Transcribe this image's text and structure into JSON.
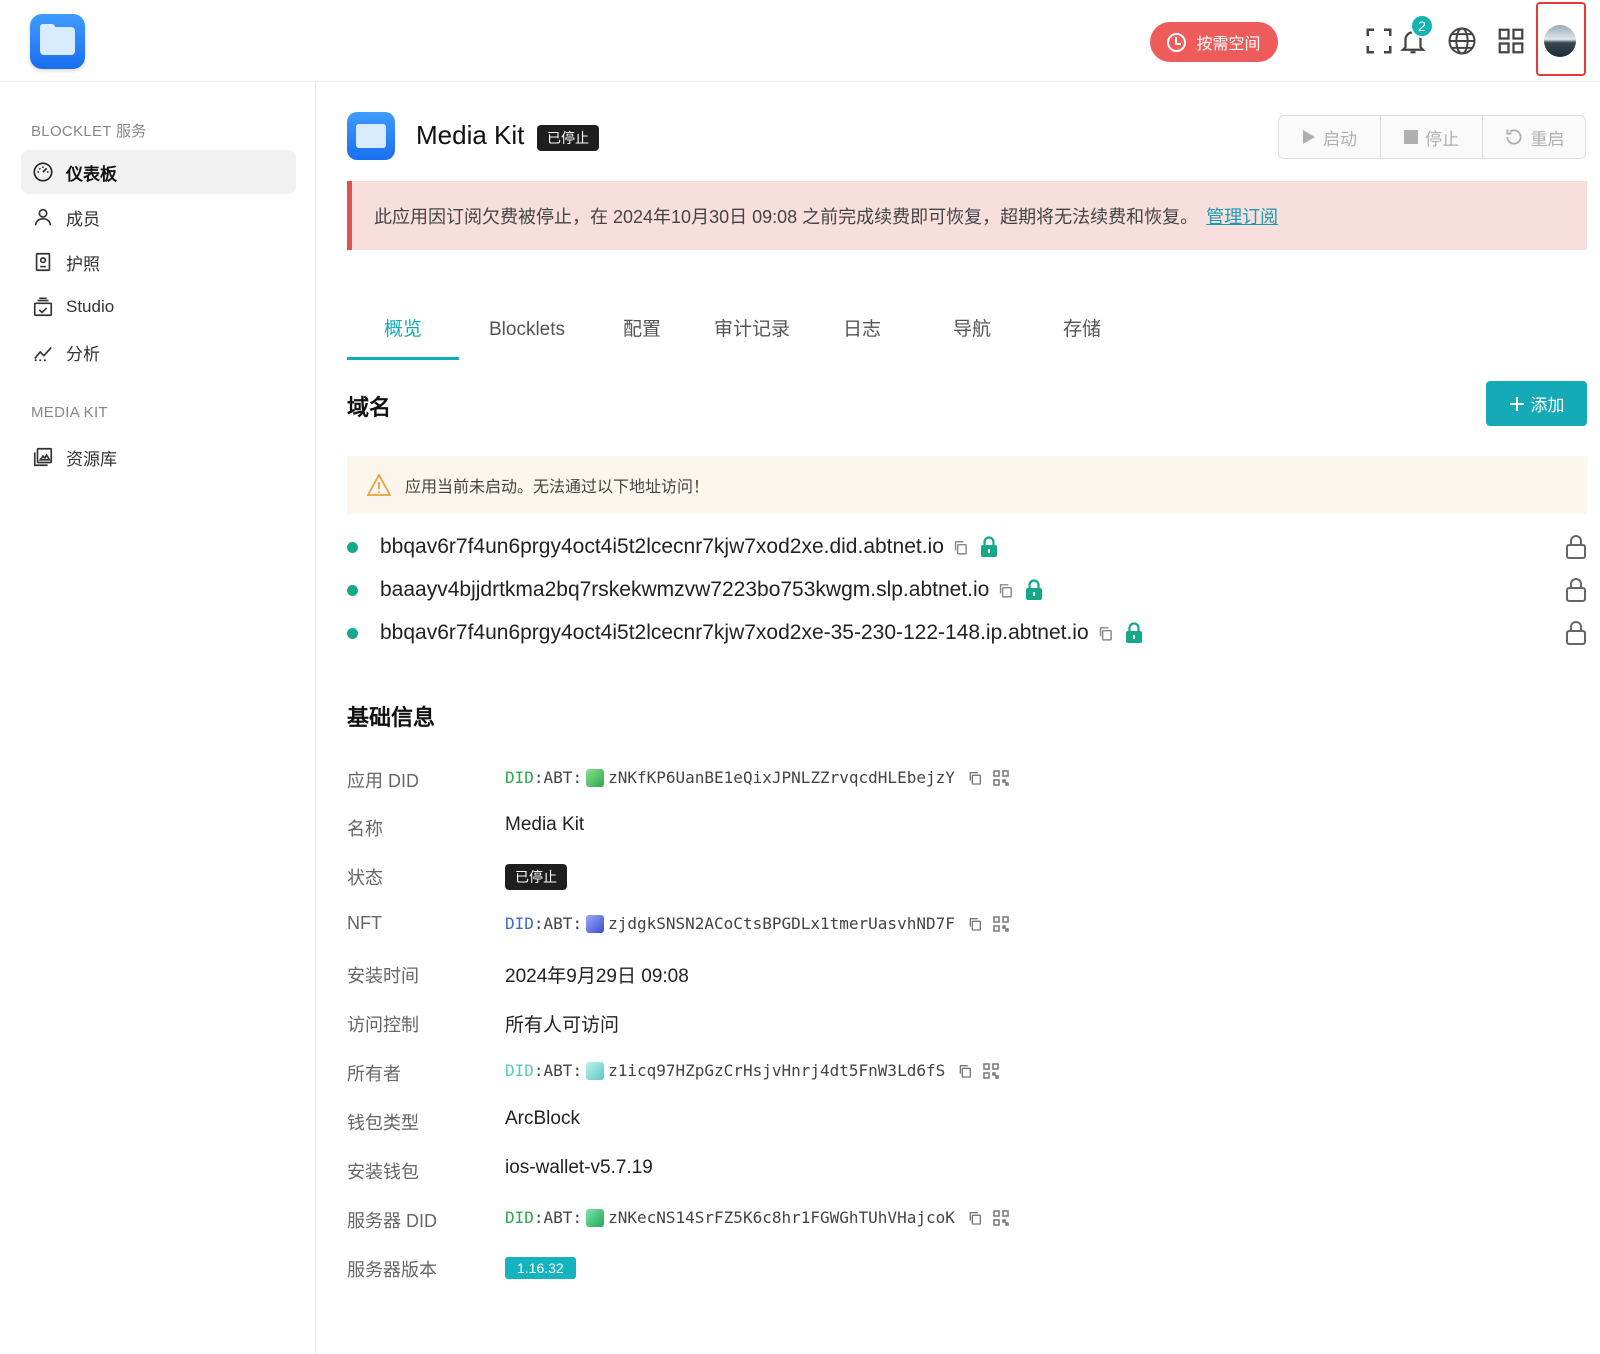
{
  "header": {
    "ondemand_label": "按需空间",
    "notification_count": "2"
  },
  "sidebar": {
    "section1": "BLOCKLET 服务",
    "items": [
      {
        "label": "仪表板",
        "icon": "dashboard-icon"
      },
      {
        "label": "成员",
        "icon": "user-icon"
      },
      {
        "label": "护照",
        "icon": "passport-icon"
      },
      {
        "label": "Studio",
        "icon": "studio-icon"
      },
      {
        "label": "分析",
        "icon": "analytics-icon"
      }
    ],
    "section2": "MEDIA KIT",
    "items2": [
      {
        "label": "资源库",
        "icon": "library-icon"
      }
    ]
  },
  "app": {
    "title": "Media Kit",
    "status": "已停止",
    "controls": {
      "start": "启动",
      "stop": "停止",
      "restart": "重启"
    }
  },
  "alert": {
    "text": "此应用因订阅欠费被停止，在 2024年10月30日 09:08 之前完成续费即可恢复，超期将无法续费和恢复。",
    "link": "管理订阅"
  },
  "tabs": [
    "概览",
    "Blocklets",
    "配置",
    "审计记录",
    "日志",
    "导航",
    "存储"
  ],
  "domains": {
    "title": "域名",
    "add_label": "添加",
    "warning": "应用当前未启动。无法通过以下地址访问！",
    "list": [
      "bbqav6r7f4un6prgy4oct4i5t2lcecnr7kjw7xod2xe.did.abtnet.io",
      "baaayv4bjjdrtkma2bq7rskekwmzvw7223bo753kwgm.slp.abtnet.io",
      "bbqav6r7f4un6prgy4oct4i5t2lcecnr7kjw7xod2xe-35-230-122-148.ip.abtnet.io"
    ]
  },
  "basic_info": {
    "title": "基础信息",
    "labels": {
      "app_did": "应用 DID",
      "name": "名称",
      "status": "状态",
      "nft": "NFT",
      "install_time": "安装时间",
      "access": "访问控制",
      "owner": "所有者",
      "wallet_type": "钱包类型",
      "install_wallet": "安装钱包",
      "server_did": "服务器 DID",
      "server_version": "服务器版本"
    },
    "values": {
      "did_prefix_did": "DID",
      "did_prefix_abt": ":ABT:",
      "app_did": "zNKfKP6UanBE1eQixJPNLZZrvqcdHLEbejzY",
      "name": "Media Kit",
      "status": "已停止",
      "nft": "zjdgkSNSN2ACoCtsBPGDLx1tmerUasvhND7F",
      "install_time": "2024年9月29日 09:08",
      "access": "所有人可访问",
      "owner": "z1icq97HZpGzCrHsjvHnrj4dt5FnW3Ld6fS",
      "wallet_type": "ArcBlock",
      "install_wallet": "ios-wallet-v5.7.19",
      "server_did": "zNKecNS14SrFZ5K6c8hr1FGWGhTUhVHajcoK",
      "server_version": "1.16.32"
    }
  }
}
